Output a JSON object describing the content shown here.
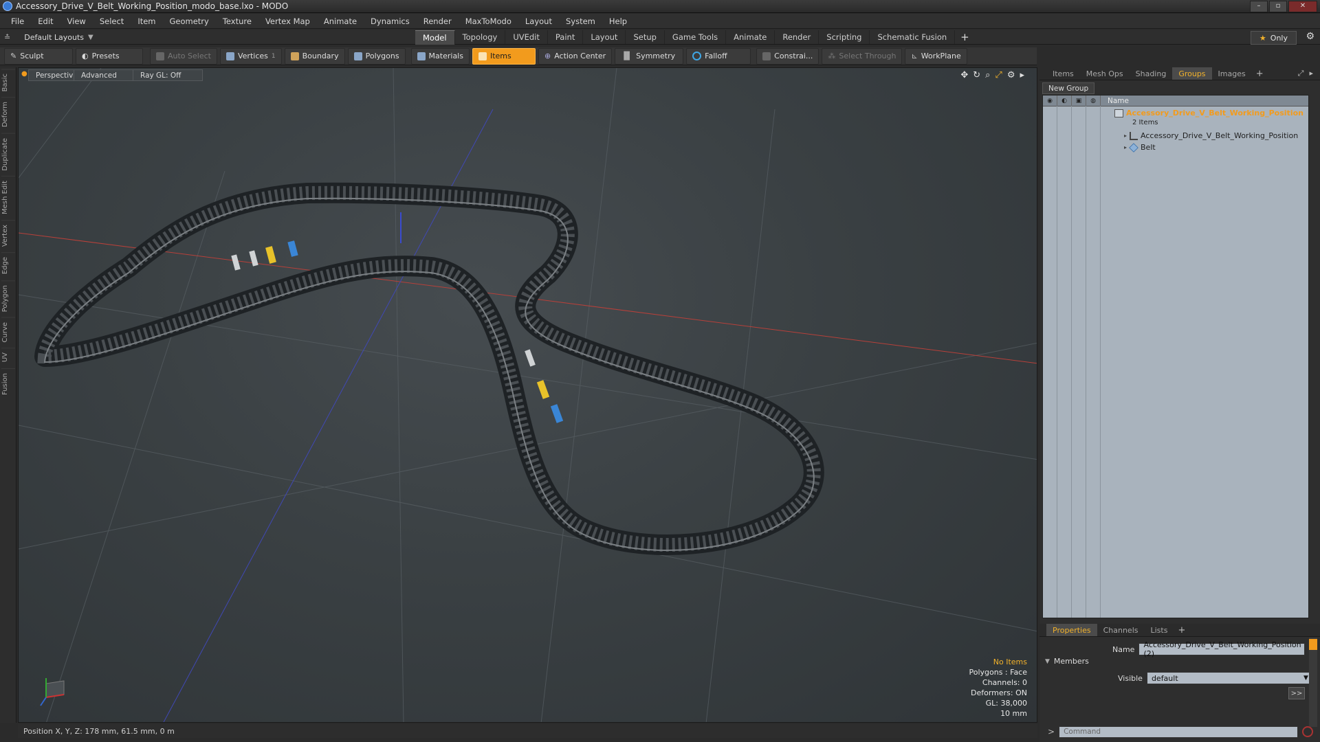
{
  "window": {
    "title": "Accessory_Drive_V_Belt_Working_Position_modo_base.lxo - MODO",
    "controls": [
      "–",
      "▫",
      "✕"
    ]
  },
  "menu": [
    "File",
    "Edit",
    "View",
    "Select",
    "Item",
    "Geometry",
    "Texture",
    "Vertex Map",
    "Animate",
    "Dynamics",
    "Render",
    "MaxToModo",
    "Layout",
    "System",
    "Help"
  ],
  "layout_selector": "Default Layouts",
  "tabs": [
    "Model",
    "Topology",
    "UVEdit",
    "Paint",
    "Layout",
    "Setup",
    "Game Tools",
    "Animate",
    "Render",
    "Scripting",
    "Schematic Fusion"
  ],
  "active_tab": "Model",
  "only_label": "Only",
  "toolbar": {
    "sculpt": "Sculpt",
    "presets": "Presets",
    "auto_select": "Auto Select",
    "vertices": "Vertices",
    "vertices_count": "1",
    "boundary": "Boundary",
    "polygons": "Polygons",
    "materials": "Materials",
    "items": "Items",
    "action_center": "Action Center",
    "symmetry": "Symmetry",
    "falloff": "Falloff",
    "constraints": "Constrai...",
    "select_through": "Select Through",
    "workplane": "WorkPlane"
  },
  "left_tabs": [
    "Basic",
    "Deform",
    "Duplicate",
    "Mesh Edit",
    "Vertex",
    "Edge",
    "Polygon",
    "Curve",
    "UV",
    "Fusion"
  ],
  "viewport": {
    "view": "Perspective",
    "shading": "Advanced",
    "raygl": "Ray GL: Off",
    "stats": {
      "no_items": "No Items",
      "polygons": "Polygons : Face",
      "channels": "Channels: 0",
      "deformers": "Deformers: ON",
      "gl": "GL: 38,000",
      "scale": "10 mm"
    }
  },
  "status": {
    "position": "Position X, Y, Z:   178 mm, 61.5 mm, 0 m"
  },
  "right_panel": {
    "tabs": [
      "Items",
      "Mesh Ops",
      "Shading",
      "Groups",
      "Images"
    ],
    "active_tab": "Groups",
    "new_group": "New Group",
    "list_header": "Name",
    "group": {
      "name": "Accessory_Drive_V_Belt_Working_Position",
      "count": "2 Items",
      "children": [
        "Accessory_Drive_V_Belt_Working_Position",
        "Belt"
      ]
    }
  },
  "properties": {
    "tabs": [
      "Properties",
      "Channels",
      "Lists"
    ],
    "active_tab": "Properties",
    "name_label": "Name",
    "name_value": "Accessory_Drive_V_Belt_Working_Position (2)",
    "members_label": "Members",
    "visible_label": "Visible",
    "visible_value": "default",
    "more_btn": ">>"
  },
  "command": {
    "prompt": ">",
    "placeholder": "Command"
  },
  "colors": {
    "accent": "#f29b1d",
    "list_bg": "#a9b3bd",
    "viewport_bg": "#3a4043"
  }
}
